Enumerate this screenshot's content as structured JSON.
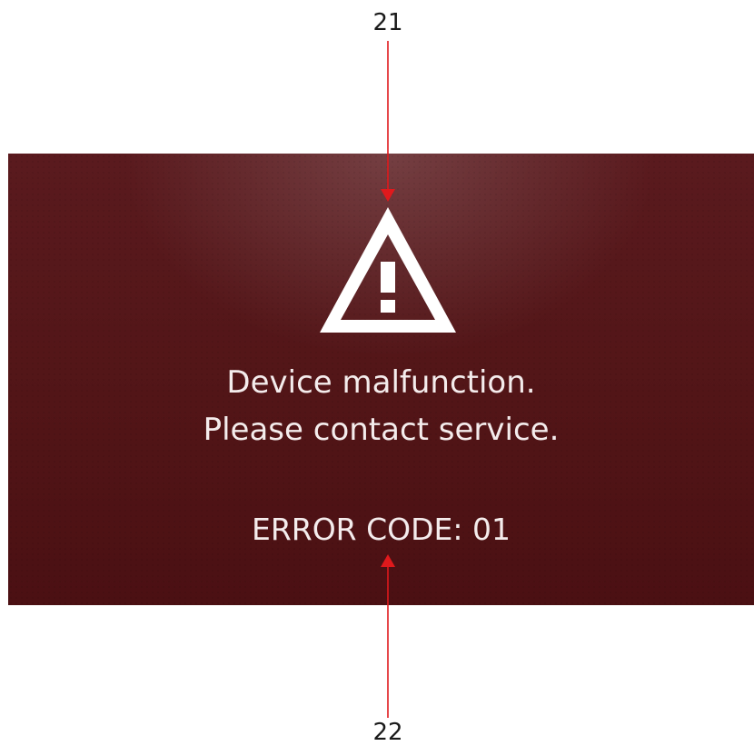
{
  "annotations": {
    "icon_ref": "21",
    "code_ref": "22",
    "leader_color": "#e0191c"
  },
  "screen": {
    "icon": "warning-triangle-icon",
    "message_line1": "Device malfunction.",
    "message_line2": "Please contact service.",
    "error_code": "ERROR CODE: 01",
    "background_color": "#521517",
    "text_color": "#f4ecec"
  }
}
